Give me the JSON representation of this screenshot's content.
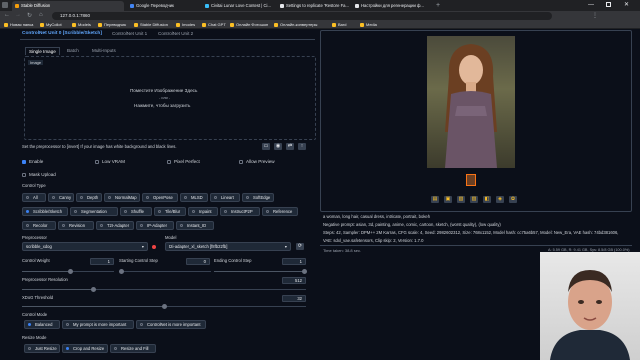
{
  "browser": {
    "tabs": [
      {
        "label": "Stable Diffusion"
      },
      {
        "label": "Google Переводчик"
      },
      {
        "label": "Civitai Lunar Love Contest | Ci..."
      },
      {
        "label": "Settings to replicate 'Restore Fa..."
      },
      {
        "label": "Настройки для регенерации ф..."
      }
    ],
    "url": "127.0.0.1:7860",
    "bookmarks": [
      "Новая папка",
      "MyCollot",
      "Models",
      "Переводчик",
      "Stable Diffusion",
      "Imodes",
      "Chat GPT",
      "Онлайн Фотошоп",
      "Онлайн-конвертеры",
      "Bard",
      "Media"
    ]
  },
  "controlnet": {
    "header": "ControlNet Unit 0 [Scribble/Sketch]",
    "unit_tabs": [
      "ControlNet Unit 1",
      "ControlNet Unit 2"
    ],
    "image_tabs": [
      "Single Image",
      "Batch",
      "Multi-Inputs"
    ],
    "image_label": "Image",
    "drop_line1": "Поместите Изображение Здесь",
    "drop_or": "- или -",
    "drop_line2": "Нажмите, чтобы загрузить",
    "hint": "Set the preprocessor to [invert] If your image has white background and black lines.",
    "checkboxes": [
      {
        "label": "Enable",
        "checked": true
      },
      {
        "label": "Low VRAM",
        "checked": false
      },
      {
        "label": "Pixel Perfect",
        "checked": false
      },
      {
        "label": "Allow Preview",
        "checked": false
      }
    ],
    "mask_upload": "Mask Upload",
    "control_type_label": "Control Type",
    "control_types_row1": [
      "All",
      "Canny",
      "Depth",
      "NormalMap",
      "OpenPose",
      "MLSD",
      "Lineart",
      "SoftEdge"
    ],
    "control_types_row2": [
      "Scribble/Sketch",
      "Segmentation",
      "Shuffle",
      "Tile/Blur",
      "Inpaint",
      "InstructP2P",
      "Reference"
    ],
    "control_types_row3": [
      "Recolor",
      "Revision",
      "T2I-Adapter",
      "IP-Adapter",
      "Instant_ID"
    ],
    "selected_type": "Scribble/Sketch",
    "preprocessor_label": "Preprocessor",
    "preprocessor_value": "scribble_xdog",
    "model_label": "Model",
    "model_value": "t2i-adapter_xl_sketch [f8fb22fb]",
    "control_weight_label": "Control Weight",
    "control_weight": "1",
    "starting_step_label": "Starting Control Step",
    "starting_step": "0",
    "ending_step_label": "Ending Control Step",
    "ending_step": "1",
    "pre_res_label": "Preprocessor Resolution",
    "pre_res": "512",
    "xdog_label": "XDoG Threshold",
    "xdog": "32",
    "control_mode_label": "Control Mode",
    "control_modes": [
      "Balanced",
      "My prompt is more important",
      "ControlNet is more important"
    ],
    "resize_mode_label": "Resize Mode",
    "resize_modes": [
      "Just Resize",
      "Crop and Resize",
      "Resize and Fill"
    ]
  },
  "output": {
    "prompt": "a woman, long hair, casual dress, intricate, portrait, bokeh",
    "negative": "Negative prompt: asian, 3d, painting, anime, comic, cartoon, sketch, (worst quality), (low quality)",
    "params": "Steps: 42, Sampler: DPM++ 2M Karras, CFG scale: 4, Seed: 2982602312, Size: 768x1152, Model hash: cc75a6b57, Model: New_Era, VAE hash: 74bd381606,",
    "params2": "VAE: sdxl_vae.safetensors, Clip skip: 2, Version: 1.7.0",
    "time": "Time taken: 38.8 sec.",
    "vram": "A: 5.59 GB, R: 9.41 GB, Sys: 8.5/8 GB (100.0%)"
  }
}
